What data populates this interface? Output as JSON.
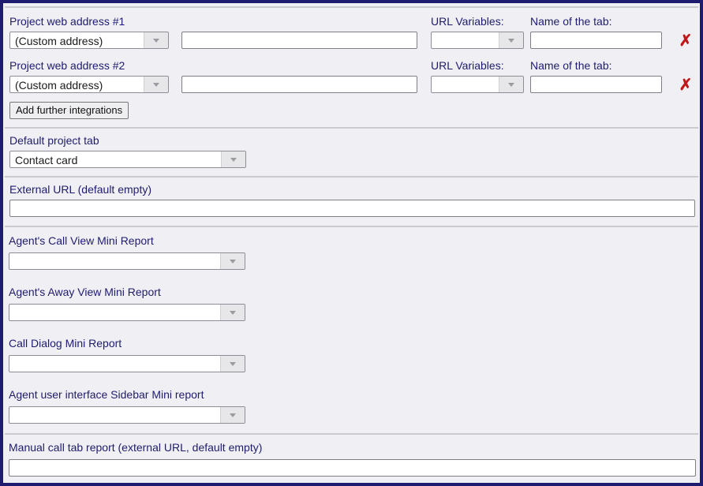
{
  "integrations": [
    {
      "label": "Project web address #1",
      "address_select": "(Custom address)",
      "url_value": "",
      "url_variables_label": "URL Variables:",
      "url_variables_value": "",
      "tab_name_label": "Name of the tab:",
      "tab_name_value": "",
      "remove_icon": "cross-icon"
    },
    {
      "label": "Project web address #2",
      "address_select": "(Custom address)",
      "url_value": "",
      "url_variables_label": "URL Variables:",
      "url_variables_value": "",
      "tab_name_label": "Name of the tab:",
      "tab_name_value": "",
      "remove_icon": "cross-icon"
    }
  ],
  "add_button_label": "Add further integrations",
  "default_tab": {
    "label": "Default project tab",
    "value": "Contact card"
  },
  "external_url": {
    "label": "External URL (default empty)",
    "value": ""
  },
  "mini_reports": [
    {
      "label": "Agent's Call View Mini Report",
      "value": ""
    },
    {
      "label": "Agent's Away View Mini Report",
      "value": ""
    },
    {
      "label": "Call Dialog Mini Report",
      "value": ""
    },
    {
      "label": "Agent user interface Sidebar Mini report",
      "value": ""
    }
  ],
  "manual_call_tab": {
    "label": "Manual call tab report (external URL, default empty)",
    "value": ""
  },
  "colors": {
    "frame": "#1f1b6e",
    "label": "#1f1b6e",
    "remove": "#c01818",
    "background": "#f0f0f4"
  }
}
